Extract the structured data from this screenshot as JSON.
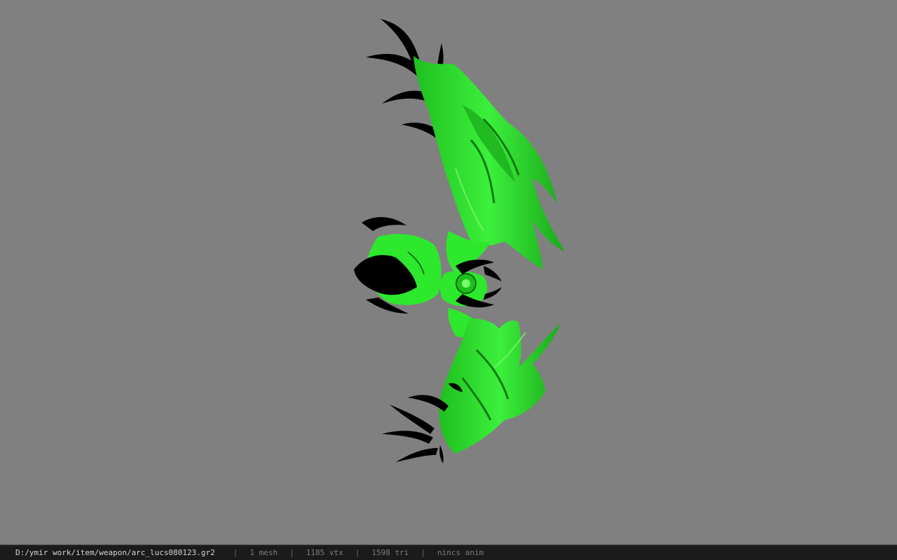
{
  "viewer": {
    "background_color": "#808080",
    "model_colors": {
      "body": "#2ee82e",
      "body_dark": "#14a814",
      "highlight": "#8cff7a",
      "blades": "#000000"
    }
  },
  "status": {
    "file_path": "D:/ymir work/item/weapon/arc_lucs080123.gr2",
    "separator": "|",
    "mesh": "1 mesh",
    "vertices": "1185 vtx",
    "triangles": "1598 tri",
    "anim": "nincs anim"
  }
}
